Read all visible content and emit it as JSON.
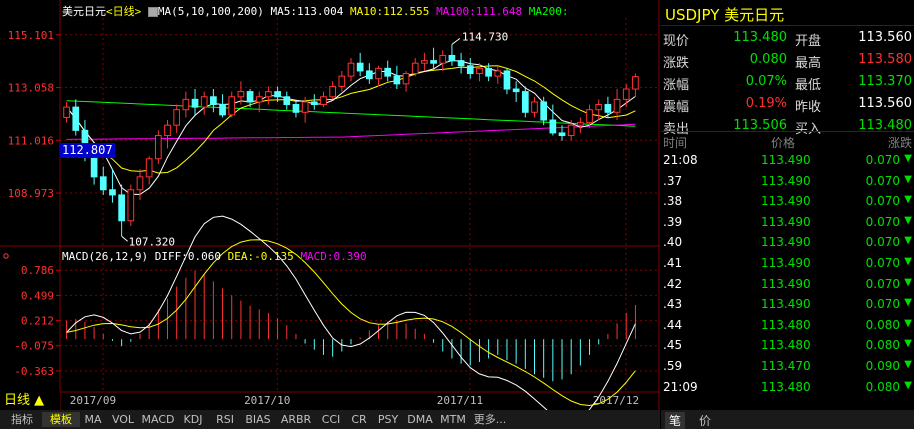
{
  "header": {
    "name": "美元日元",
    "period_tag": "<日线>",
    "ma_params": "MA(5,10,100,200)",
    "ma5": "MA5:113.004",
    "ma10": "MA10:112.555",
    "ma100": "MA100:111.648",
    "ma200": "MA200:"
  },
  "macd_header": {
    "params": "MACD(26,12,9)",
    "diff": "DIFF:0.060",
    "dea": "DEA:-0.135",
    "macd": "MACD:0.390"
  },
  "price_labels": [
    "115.101",
    "113.058",
    "111.016",
    "108.973"
  ],
  "macd_labels": [
    "0.786",
    "0.499",
    "0.212",
    "-0.075",
    "-0.363"
  ],
  "date_labels": [
    "2017/09",
    "2017/10",
    "2017/11",
    "2017/12"
  ],
  "annotations": {
    "high": "114.730",
    "low": "107.320",
    "cursor_price": "112.807"
  },
  "period_button": "日线",
  "colors": {
    "up": "#ff3232",
    "down": "#54ffff",
    "ma5": "#ffffff",
    "ma10": "#ffff00",
    "ma100": "#ff00ff",
    "ma200": "#00ff00",
    "dea": "#ffff00",
    "diff": "#ffffff"
  },
  "chart_data": {
    "type": "candlestick",
    "price_ylim": [
      107.0,
      115.75
    ],
    "macd_ylim": [
      -0.58,
      0.88
    ],
    "candles": [
      {
        "o": 111.9,
        "h": 112.5,
        "l": 111.7,
        "c": 112.3
      },
      {
        "o": 112.3,
        "h": 112.6,
        "l": 111.2,
        "c": 111.4
      },
      {
        "o": 111.4,
        "h": 111.8,
        "l": 110.2,
        "c": 110.4
      },
      {
        "o": 110.4,
        "h": 110.9,
        "l": 109.3,
        "c": 109.6
      },
      {
        "o": 109.6,
        "h": 110.0,
        "l": 108.9,
        "c": 109.1
      },
      {
        "o": 109.1,
        "h": 109.9,
        "l": 108.6,
        "c": 108.9
      },
      {
        "o": 108.9,
        "h": 109.3,
        "l": 107.3,
        "c": 107.9
      },
      {
        "o": 107.9,
        "h": 109.3,
        "l": 107.7,
        "c": 109.1
      },
      {
        "o": 109.1,
        "h": 109.9,
        "l": 108.7,
        "c": 109.6
      },
      {
        "o": 109.6,
        "h": 110.4,
        "l": 109.3,
        "c": 110.3
      },
      {
        "o": 110.3,
        "h": 111.4,
        "l": 110.1,
        "c": 111.2
      },
      {
        "o": 111.2,
        "h": 111.8,
        "l": 110.7,
        "c": 111.6
      },
      {
        "o": 111.6,
        "h": 112.4,
        "l": 111.3,
        "c": 112.2
      },
      {
        "o": 112.2,
        "h": 112.9,
        "l": 111.9,
        "c": 112.6
      },
      {
        "o": 112.6,
        "h": 113.0,
        "l": 112.0,
        "c": 112.3
      },
      {
        "o": 112.3,
        "h": 112.9,
        "l": 112.0,
        "c": 112.7
      },
      {
        "o": 112.7,
        "h": 113.0,
        "l": 112.1,
        "c": 112.4
      },
      {
        "o": 112.4,
        "h": 112.8,
        "l": 111.9,
        "c": 112.0
      },
      {
        "o": 112.0,
        "h": 112.9,
        "l": 111.9,
        "c": 112.7
      },
      {
        "o": 112.7,
        "h": 113.3,
        "l": 112.4,
        "c": 112.9
      },
      {
        "o": 112.9,
        "h": 113.0,
        "l": 112.3,
        "c": 112.5
      },
      {
        "o": 112.5,
        "h": 112.9,
        "l": 112.1,
        "c": 112.7
      },
      {
        "o": 112.7,
        "h": 113.1,
        "l": 112.4,
        "c": 112.9
      },
      {
        "o": 112.9,
        "h": 113.1,
        "l": 112.5,
        "c": 112.7
      },
      {
        "o": 112.7,
        "h": 112.9,
        "l": 112.2,
        "c": 112.4
      },
      {
        "o": 112.4,
        "h": 112.6,
        "l": 111.9,
        "c": 112.1
      },
      {
        "o": 112.1,
        "h": 112.7,
        "l": 111.7,
        "c": 112.5
      },
      {
        "o": 112.5,
        "h": 112.8,
        "l": 112.2,
        "c": 112.4
      },
      {
        "o": 112.4,
        "h": 112.9,
        "l": 112.3,
        "c": 112.7
      },
      {
        "o": 112.7,
        "h": 113.3,
        "l": 112.6,
        "c": 113.1
      },
      {
        "o": 113.1,
        "h": 113.7,
        "l": 112.9,
        "c": 113.5
      },
      {
        "o": 113.5,
        "h": 114.2,
        "l": 113.3,
        "c": 114.0
      },
      {
        "o": 114.0,
        "h": 114.4,
        "l": 113.5,
        "c": 113.7
      },
      {
        "o": 113.7,
        "h": 114.0,
        "l": 113.2,
        "c": 113.4
      },
      {
        "o": 113.4,
        "h": 113.9,
        "l": 113.1,
        "c": 113.8
      },
      {
        "o": 113.8,
        "h": 114.1,
        "l": 113.3,
        "c": 113.5
      },
      {
        "o": 113.5,
        "h": 113.9,
        "l": 113.0,
        "c": 113.2
      },
      {
        "o": 113.2,
        "h": 113.7,
        "l": 112.9,
        "c": 113.6
      },
      {
        "o": 113.6,
        "h": 114.2,
        "l": 113.5,
        "c": 114.0
      },
      {
        "o": 114.0,
        "h": 114.4,
        "l": 113.7,
        "c": 114.1
      },
      {
        "o": 114.1,
        "h": 114.6,
        "l": 113.8,
        "c": 114.0
      },
      {
        "o": 114.0,
        "h": 114.5,
        "l": 113.7,
        "c": 114.3
      },
      {
        "o": 114.3,
        "h": 114.73,
        "l": 113.9,
        "c": 114.1
      },
      {
        "o": 114.1,
        "h": 114.4,
        "l": 113.6,
        "c": 113.9
      },
      {
        "o": 113.9,
        "h": 114.2,
        "l": 113.4,
        "c": 113.6
      },
      {
        "o": 113.6,
        "h": 114.0,
        "l": 113.3,
        "c": 113.8
      },
      {
        "o": 113.8,
        "h": 114.0,
        "l": 113.3,
        "c": 113.5
      },
      {
        "o": 113.5,
        "h": 113.9,
        "l": 113.2,
        "c": 113.7
      },
      {
        "o": 113.7,
        "h": 113.8,
        "l": 112.8,
        "c": 113.0
      },
      {
        "o": 113.0,
        "h": 113.3,
        "l": 112.5,
        "c": 112.9
      },
      {
        "o": 112.9,
        "h": 113.1,
        "l": 111.9,
        "c": 112.1
      },
      {
        "o": 112.1,
        "h": 112.7,
        "l": 111.9,
        "c": 112.5
      },
      {
        "o": 112.5,
        "h": 112.7,
        "l": 111.6,
        "c": 111.8
      },
      {
        "o": 111.8,
        "h": 112.4,
        "l": 111.2,
        "c": 111.3
      },
      {
        "o": 111.3,
        "h": 111.6,
        "l": 111.0,
        "c": 111.2
      },
      {
        "o": 111.2,
        "h": 111.8,
        "l": 111.0,
        "c": 111.6
      },
      {
        "o": 111.6,
        "h": 111.9,
        "l": 111.3,
        "c": 111.7
      },
      {
        "o": 111.7,
        "h": 112.4,
        "l": 111.5,
        "c": 112.2
      },
      {
        "o": 112.2,
        "h": 112.6,
        "l": 111.8,
        "c": 112.4
      },
      {
        "o": 112.4,
        "h": 112.7,
        "l": 111.9,
        "c": 112.1
      },
      {
        "o": 112.1,
        "h": 113.0,
        "l": 111.8,
        "c": 112.6
      },
      {
        "o": 112.6,
        "h": 113.2,
        "l": 112.3,
        "c": 113.0
      },
      {
        "o": 113.0,
        "h": 113.6,
        "l": 112.7,
        "c": 113.48
      }
    ],
    "macd_hist": [
      0.21,
      0.23,
      0.2,
      0.14,
      0.06,
      -0.02,
      -0.08,
      -0.03,
      0.06,
      0.18,
      0.34,
      0.46,
      0.6,
      0.7,
      0.78,
      0.74,
      0.66,
      0.58,
      0.5,
      0.44,
      0.38,
      0.34,
      0.3,
      0.24,
      0.16,
      0.06,
      -0.05,
      -0.12,
      -0.18,
      -0.2,
      -0.14,
      -0.06,
      0.02,
      0.1,
      0.16,
      0.2,
      0.22,
      0.18,
      0.12,
      0.06,
      -0.04,
      -0.14,
      -0.22,
      -0.28,
      -0.3,
      -0.26,
      -0.22,
      -0.18,
      -0.24,
      -0.28,
      -0.34,
      -0.4,
      -0.44,
      -0.48,
      -0.46,
      -0.4,
      -0.3,
      -0.18,
      -0.06,
      0.06,
      0.18,
      0.3,
      0.39
    ]
  },
  "quote": {
    "title": "USDJPY 美元日元",
    "rows": [
      {
        "l1": "现价",
        "v1": "113.480",
        "c1": "#00e000",
        "l2": "开盘",
        "v2": "113.560",
        "c2": "#ffffff"
      },
      {
        "l1": "涨跌",
        "v1": "0.080",
        "c1": "#00e000",
        "l2": "最高",
        "v2": "113.580",
        "c2": "#ff3030"
      },
      {
        "l1": "涨幅",
        "v1": "0.07%",
        "c1": "#00e000",
        "l2": "最低",
        "v2": "113.370",
        "c2": "#00e000"
      },
      {
        "l1": "震幅",
        "v1": "0.19%",
        "c1": "#ff3030",
        "l2": "昨收",
        "v2": "113.560",
        "c2": "#ffffff"
      },
      {
        "l1": "卖出",
        "v1": "113.506",
        "c1": "#00e000",
        "l2": "买入",
        "v2": "113.480",
        "c2": "#00e000"
      }
    ]
  },
  "ticks_header": {
    "time": "时间",
    "price": "价格",
    "change": "涨跌"
  },
  "ticks": [
    {
      "t": "21:08",
      "p": "113.490",
      "c": "0.070"
    },
    {
      "t": ".37",
      "p": "113.490",
      "c": "0.070"
    },
    {
      "t": ".38",
      "p": "113.490",
      "c": "0.070"
    },
    {
      "t": ".39",
      "p": "113.490",
      "c": "0.070"
    },
    {
      "t": ".40",
      "p": "113.490",
      "c": "0.070"
    },
    {
      "t": ".41",
      "p": "113.490",
      "c": "0.070"
    },
    {
      "t": ".42",
      "p": "113.490",
      "c": "0.070"
    },
    {
      "t": ".43",
      "p": "113.490",
      "c": "0.070"
    },
    {
      "t": ".44",
      "p": "113.480",
      "c": "0.080"
    },
    {
      "t": ".45",
      "p": "113.480",
      "c": "0.080"
    },
    {
      "t": ".59",
      "p": "113.470",
      "c": "0.090"
    },
    {
      "t": "21:09",
      "p": "113.480",
      "c": "0.080"
    }
  ],
  "tabs": [
    "指标",
    "模板",
    "MA",
    "VOL",
    "MACD",
    "KDJ",
    "RSI",
    "BIAS",
    "ARBR",
    "CCI",
    "CR",
    "PSY",
    "DMA",
    "MTM",
    "更多..."
  ],
  "right_tabs": [
    "笔",
    "价"
  ]
}
